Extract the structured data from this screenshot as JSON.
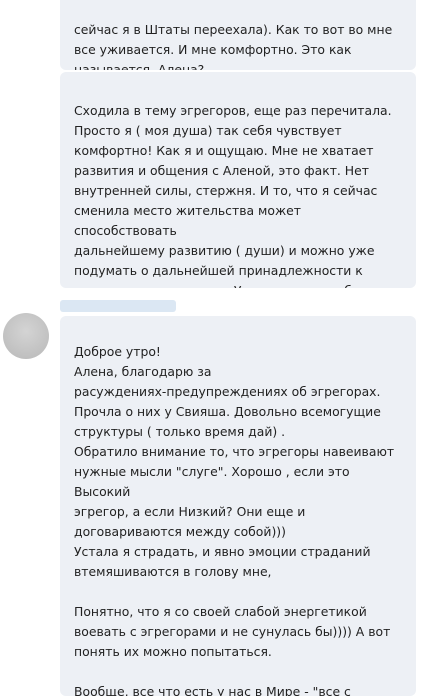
{
  "messages": [
    {
      "text": "сейчас я в  Штаты переехала). Как то вот во мне\nвсе уживается.  И мне комфортно. Это как\nназывается, Алена?"
    },
    {
      "text": "Сходила в тему эгрегоров, еще раз перечитала.\nПросто я ( моя душа) так себя чувствует\nкомфортно! Как я  и ощущаю. Мне не хватает\nразвития и общения с Аленой, это факт. Нет\nвнутренней силы, стержня. И то, что я сейчас\nсменила место жительства может способствовать\nдальнейшему развитию ( души) и можно уже\nподумать о дальнейшей принадлежности к\nэгрегору христианства. Ух,  как я сама себя\nпоизучала))"
    },
    {
      "text": "Доброе утро!\nАлена, благодарю за\nрасуждениях-предупреждениях  об эгрегорах.\nПрочла о них у Свияша. Довольно всемогущие\nструктуры ( только время дай) .\nОбратило внимание то, что эгрегоры навеивают\nнужные мысли \"слуге\". Хорошо , если это Высокий\nэгрегор, а если Низкий? Они еще и\nдоговариваются между собой)))\nУстала я страдать, и явно эмоции страданий\nвтемяшиваются в голову мне,\n\nПонятно, что я со своей слабой энергетикой\nвоевать с эгрегорами и не сунулась бы)))) А вот\nпонять их можно попытаться.\n\nВообще, все что есть у нас в Мире - \"все с\nведома и разрешения Высших\" ( это Алена"
    }
  ]
}
